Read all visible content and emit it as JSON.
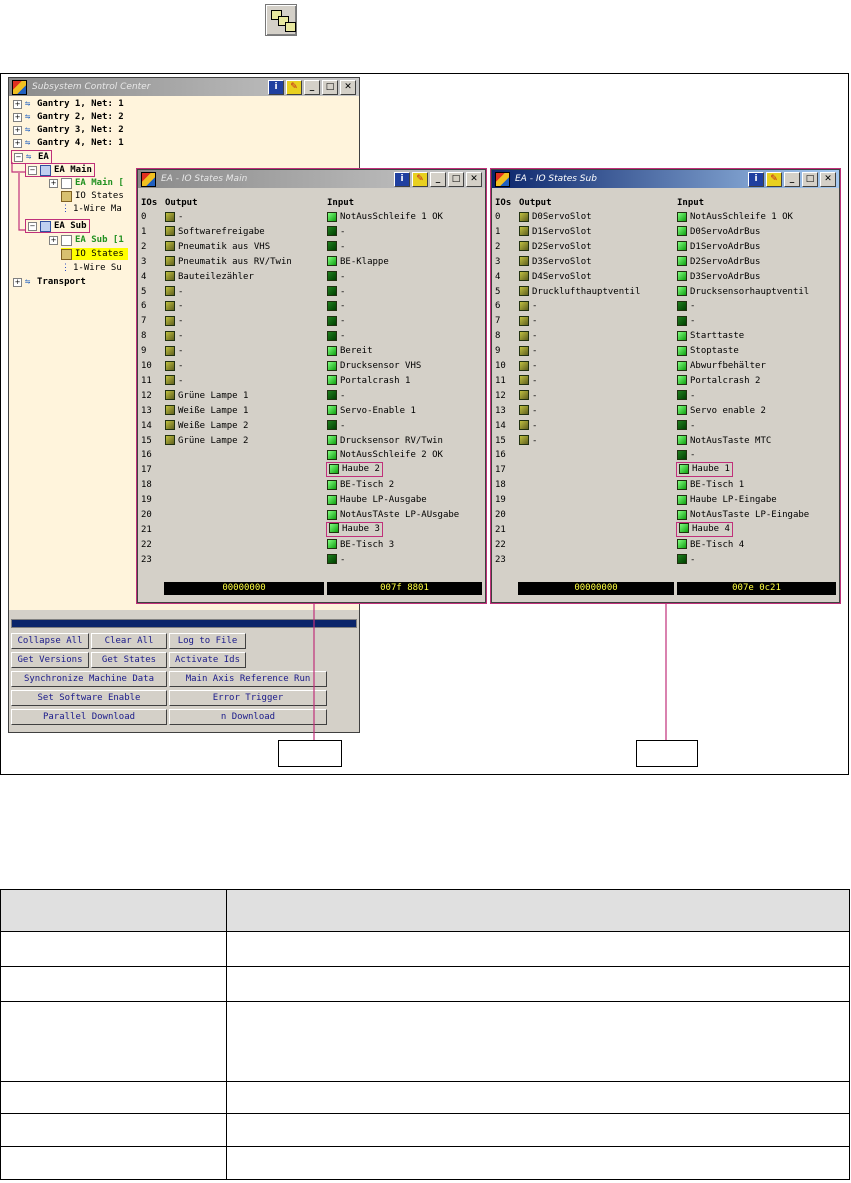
{
  "subsystem_window": {
    "title": "Subsystem Control Center",
    "tree": [
      {
        "label": "Gantry 1, Net: 1"
      },
      {
        "label": "Gantry 2, Net: 2"
      },
      {
        "label": "Gantry 3, Net: 2"
      },
      {
        "label": "Gantry 4, Net: 1"
      },
      {
        "label": "EA"
      },
      {
        "label": "EA Main"
      },
      {
        "label": "EA Main ["
      },
      {
        "label": "IO States"
      },
      {
        "label": "1-Wire Ma"
      },
      {
        "label": "EA Sub"
      },
      {
        "label": "EA Sub [1"
      },
      {
        "label": "IO States"
      },
      {
        "label": "1-Wire Su"
      },
      {
        "label": "Transport"
      }
    ],
    "buttons": [
      "Collapse All",
      "Clear All",
      "Log to File",
      "Get Versions",
      "Get States",
      "Activate Ids",
      "Synchronize Machine Data",
      "Main Axis Reference Run",
      "Set Software Enable",
      "Error Trigger",
      "Parallel Download",
      "n Download"
    ]
  },
  "io_main": {
    "title": "EA - IO States Main",
    "col_ios": "IOs",
    "col_output": "Output",
    "col_input": "Input",
    "rows": [
      {
        "n": "0",
        "out": "-",
        "in": "NotAusSchleife 1 OK"
      },
      {
        "n": "1",
        "out": "Softwarefreigabe",
        "in": "-"
      },
      {
        "n": "2",
        "out": "Pneumatik aus VHS",
        "in": "-"
      },
      {
        "n": "3",
        "out": "Pneumatik aus RV/Twin",
        "in": "BE-Klappe"
      },
      {
        "n": "4",
        "out": "Bauteilezähler",
        "in": "-"
      },
      {
        "n": "5",
        "out": "-",
        "in": "-"
      },
      {
        "n": "6",
        "out": "-",
        "in": "-"
      },
      {
        "n": "7",
        "out": "-",
        "in": "-"
      },
      {
        "n": "8",
        "out": "-",
        "in": "-"
      },
      {
        "n": "9",
        "out": "-",
        "in": "Bereit"
      },
      {
        "n": "10",
        "out": "-",
        "in": "Drucksensor VHS"
      },
      {
        "n": "11",
        "out": "-",
        "in": "Portalcrash 1"
      },
      {
        "n": "12",
        "out": "Grüne Lampe 1",
        "in": "-"
      },
      {
        "n": "13",
        "out": "Weiße Lampe 1",
        "in": "Servo-Enable 1"
      },
      {
        "n": "14",
        "out": "Weiße Lampe 2",
        "in": "-"
      },
      {
        "n": "15",
        "out": "Grüne Lampe 2",
        "in": "Drucksensor RV/Twin"
      },
      {
        "n": "16",
        "out": "",
        "in": "NotAusSchleife 2 OK"
      },
      {
        "n": "17",
        "out": "",
        "in": "Haube 2"
      },
      {
        "n": "18",
        "out": "",
        "in": "BE-Tisch 2"
      },
      {
        "n": "19",
        "out": "",
        "in": "Haube LP-Ausgabe"
      },
      {
        "n": "20",
        "out": "",
        "in": "NotAusTAste LP-AUsgabe"
      },
      {
        "n": "21",
        "out": "",
        "in": "Haube 3"
      },
      {
        "n": "22",
        "out": "",
        "in": "BE-Tisch 3"
      },
      {
        "n": "23",
        "out": "",
        "in": "-"
      }
    ],
    "hex_out": "00000000",
    "hex_in": "007f 8801"
  },
  "io_sub": {
    "title": "EA - IO States Sub",
    "col_ios": "IOs",
    "col_output": "Output",
    "col_input": "Input",
    "rows": [
      {
        "n": "0",
        "out": "D0ServoSlot",
        "in": "NotAusSchleife 1 OK"
      },
      {
        "n": "1",
        "out": "D1ServoSlot",
        "in": "D0ServoAdrBus"
      },
      {
        "n": "2",
        "out": "D2ServoSlot",
        "in": "D1ServoAdrBus"
      },
      {
        "n": "3",
        "out": "D3ServoSlot",
        "in": "D2ServoAdrBus"
      },
      {
        "n": "4",
        "out": "D4ServoSlot",
        "in": "D3ServoAdrBus"
      },
      {
        "n": "5",
        "out": "Drucklufthauptventil",
        "in": "Drucksensorhauptventil"
      },
      {
        "n": "6",
        "out": "-",
        "in": "-"
      },
      {
        "n": "7",
        "out": "-",
        "in": "-"
      },
      {
        "n": "8",
        "out": "-",
        "in": "Starttaste"
      },
      {
        "n": "9",
        "out": "-",
        "in": "Stoptaste"
      },
      {
        "n": "10",
        "out": "-",
        "in": "Abwurfbehälter"
      },
      {
        "n": "11",
        "out": "-",
        "in": "Portalcrash 2"
      },
      {
        "n": "12",
        "out": "-",
        "in": "-"
      },
      {
        "n": "13",
        "out": "-",
        "in": "Servo enable 2"
      },
      {
        "n": "14",
        "out": "-",
        "in": "-"
      },
      {
        "n": "15",
        "out": "-",
        "in": "NotAusTaste MTC"
      },
      {
        "n": "16",
        "out": "",
        "in": "-"
      },
      {
        "n": "17",
        "out": "",
        "in": "Haube 1"
      },
      {
        "n": "18",
        "out": "",
        "in": "BE-Tisch 1"
      },
      {
        "n": "19",
        "out": "",
        "in": "Haube LP-Eingabe"
      },
      {
        "n": "20",
        "out": "",
        "in": "NotAusTaste LP-Eingabe"
      },
      {
        "n": "21",
        "out": "",
        "in": "Haube 4"
      },
      {
        "n": "22",
        "out": "",
        "in": "BE-Tisch 4"
      },
      {
        "n": "23",
        "out": "",
        "in": "-"
      }
    ],
    "hex_out": "00000000",
    "hex_in": "007e 0c21"
  },
  "colors": {
    "highlight": "#c0307a",
    "tree_bg": "#fff4dc",
    "hex_text": "#ffff40"
  }
}
